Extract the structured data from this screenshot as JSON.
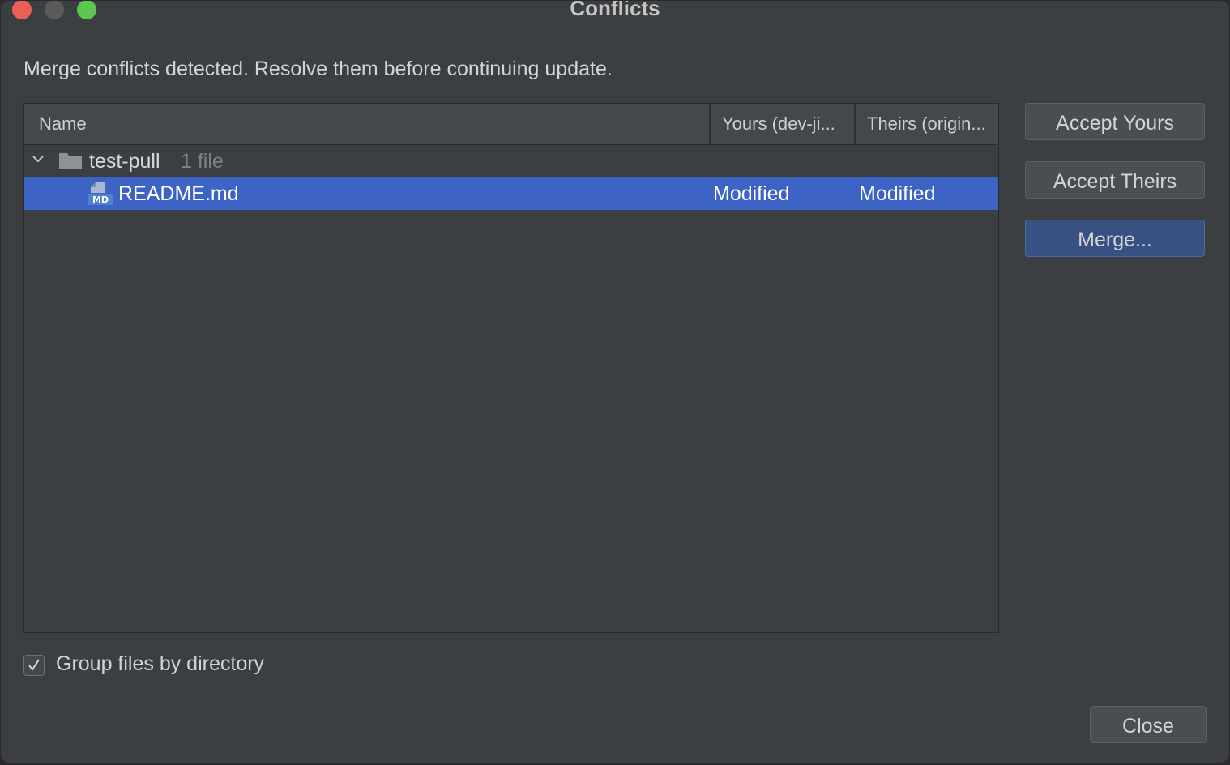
{
  "window": {
    "title": "Conflicts"
  },
  "message": "Merge conflicts detected. Resolve them before continuing update.",
  "table": {
    "columns": [
      "Name",
      "Yours (dev-ji...",
      "Theirs (origin..."
    ],
    "group": {
      "name": "test-pull",
      "count": "1 file",
      "expanded": true
    },
    "rows": [
      {
        "name": "README.md",
        "icon": "markdown-file-icon",
        "yours": "Modified",
        "theirs": "Modified",
        "selected": true
      }
    ]
  },
  "buttons": {
    "accept_yours": "Accept Yours",
    "accept_theirs": "Accept Theirs",
    "merge": "Merge...",
    "close": "Close"
  },
  "options": {
    "group_by_directory_label": "Group files by directory",
    "group_by_directory_checked": true
  },
  "colors": {
    "selection": "#3d64c4",
    "window_bg": "#3c3f41",
    "default_button": "#375183"
  }
}
